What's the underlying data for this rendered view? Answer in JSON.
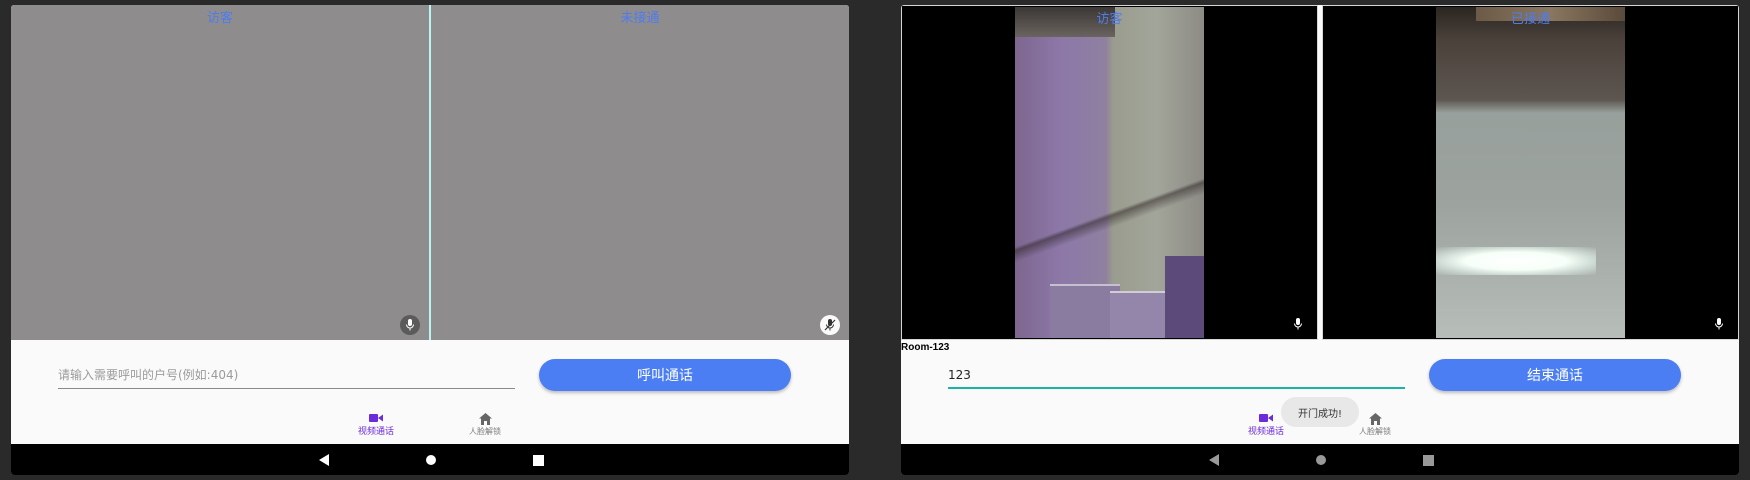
{
  "left_screen": {
    "panes": [
      {
        "label": "访客"
      },
      {
        "label": "未接通"
      }
    ],
    "input": {
      "value": "",
      "placeholder": "请输入需要呼叫的户号(例如:404)"
    },
    "action_button": "呼叫通话",
    "nav": [
      {
        "label": "视频通话",
        "icon": "video-camera-icon",
        "active": true
      },
      {
        "label": "人脸解锁",
        "icon": "home-icon",
        "active": false
      }
    ]
  },
  "right_screen": {
    "panes": [
      {
        "label": "访客"
      },
      {
        "label": "已接通"
      }
    ],
    "room_label": "Room-123",
    "input": {
      "value": "123",
      "placeholder": ""
    },
    "action_button": "结束通话",
    "toast": "开门成功!",
    "nav": [
      {
        "label": "视频通话",
        "icon": "video-camera-icon",
        "active": true
      },
      {
        "label": "人脸解锁",
        "icon": "home-icon",
        "active": false
      }
    ]
  },
  "colors": {
    "accent_blue": "#4a7ef2",
    "label_blue": "#4d7cf0",
    "nav_active": "#6b2bd9",
    "input_focus": "#18b5a5"
  }
}
